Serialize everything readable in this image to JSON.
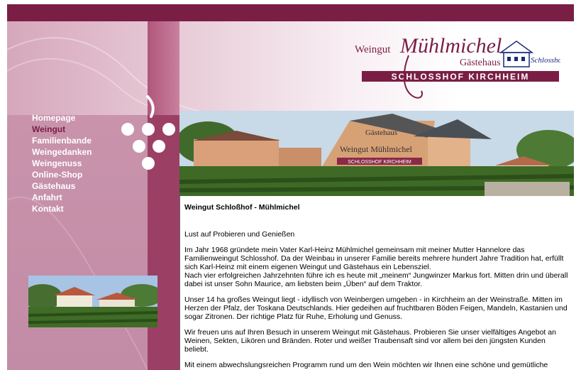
{
  "header": {
    "logo": {
      "weingut": "Weingut",
      "name": "Mühlmichel",
      "gaestehaus": "Gästehaus",
      "schlosshof_script": "Schlosshof",
      "banner": "SCHLOSSHOF KIRCHHEIM"
    }
  },
  "sidebar": {
    "nav_items": [
      {
        "label": "Homepage"
      },
      {
        "label": "Weingut"
      },
      {
        "label": "Familienbande"
      },
      {
        "label": "Weingedanken"
      },
      {
        "label": "Weingenuss"
      },
      {
        "label": "Online-Shop"
      },
      {
        "label": "Gästehaus"
      },
      {
        "label": "Anfahrt"
      },
      {
        "label": "Kontakt"
      }
    ],
    "active_item": "Weingut"
  },
  "banner": {
    "sign_gaestehaus": "Gästehaus",
    "sign_weingut": "Weingut Mühlmichel",
    "sign_schlosshof": "SCHLOSSHOF KIRCHHEIM"
  },
  "content": {
    "title": "Weingut Schloßhof - Mühlmichel",
    "subtitle": "Lust auf Probieren und Genießen",
    "paragraph_1": "Im Jahr 1968 gründete mein Vater Karl-Heinz Mühlmichel gemeinsam mit meiner Mutter Hannelore das Familienweingut Schlosshof. Da der Weinbau in unserer Familie bereits mehrere hundert Jahre Tradition hat, erfüllt sich Karl-Heinz mit einem eigenen Weingut und Gästehaus ein Lebensziel.",
    "paragraph_1b": "Nach vier erfolgreichen Jahrzehnten führe ich es heute mit „meinem“ Jungwinzer Markus fort. Mitten drin und überall dabei ist unser Sohn Maurice, am liebsten beim „Üben“ auf dem Traktor.",
    "paragraph_2": "Unser 14 ha großes Weingut liegt - idyllisch von Weinbergen umgeben - in Kirchheim an der Weinstraße. Mitten im Herzen der Pfalz, der Toskana Deutschlands. Hier gedeihen auf fruchtbaren Böden Feigen, Mandeln, Kastanien und sogar Zitronen. Der richtige Platz für Ruhe, Erholung und Genuss.",
    "paragraph_3": "Wir freuen uns auf Ihren Besuch in unserem Weingut mit Gästehaus. Probieren Sie unser vielfältiges Angebot an Weinen, Sekten, Likören und Bränden. Roter und weißer Traubensaft sind vor allem bei den jüngsten Kunden beliebt.",
    "paragraph_4": "Mit einem abwechslungsreichen Programm rund um den Wein möchten wir Ihnen eine schöne und gemütliche"
  },
  "colors": {
    "brand": "#7a1e45",
    "accent": "#9c3f65",
    "sidebar": "#c893ab"
  }
}
